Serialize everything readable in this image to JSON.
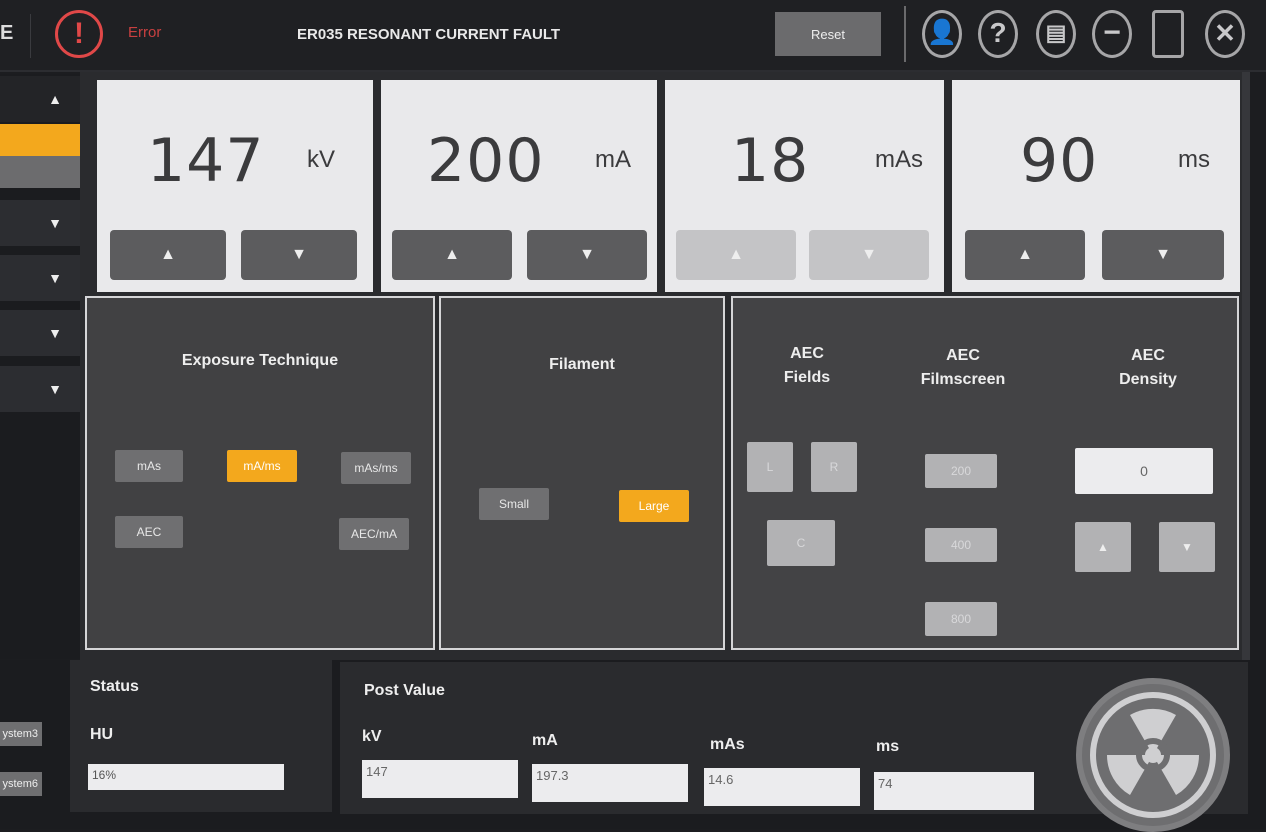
{
  "header": {
    "logo": "E",
    "error_icon": "!",
    "error_label": "Error",
    "message": "ER035 RESONANT CURRENT FAULT",
    "reset_label": "Reset",
    "icons": [
      "user-icon",
      "help-icon",
      "notes-icon",
      "minimize-icon",
      "window-icon",
      "close-icon"
    ],
    "icon_glyphs": [
      "👤",
      "?",
      "▤",
      "−",
      "",
      "✕"
    ]
  },
  "sidebar": {
    "up_arrow": "▲",
    "down_arrow": "▼",
    "system_buttons": [
      "ystem3",
      "ystem6"
    ]
  },
  "values": [
    {
      "value": "147",
      "unit": "kV",
      "up": "▲",
      "down": "▼",
      "enabled": true
    },
    {
      "value": "200",
      "unit": "mA",
      "up": "▲",
      "down": "▼",
      "enabled": true
    },
    {
      "value": "18",
      "unit": "mAs",
      "up": "▲",
      "down": "▼",
      "enabled": false
    },
    {
      "value": "90",
      "unit": "ms",
      "up": "▲",
      "down": "▼",
      "enabled": true
    }
  ],
  "exposure": {
    "title": "Exposure Technique",
    "options": [
      "mAs",
      "mA/ms",
      "mAs/ms",
      "AEC",
      "AEC/mA"
    ],
    "selected": "mA/ms"
  },
  "filament": {
    "title": "Filament",
    "options": [
      "Small",
      "Large"
    ],
    "selected": "Large"
  },
  "aec": {
    "fields_title": "AEC\nFields",
    "filmscreen_title": "AEC\nFilmscreen",
    "density_title": "AEC\nDensity",
    "fields": [
      "L",
      "R",
      "C"
    ],
    "filmscreen": [
      "200",
      "400",
      "800"
    ],
    "density": "0",
    "up": "▲",
    "down": "▼"
  },
  "status": {
    "title": "Status",
    "hu_label": "HU",
    "hu_value": "16%"
  },
  "post": {
    "title": "Post Value",
    "labels": [
      "kV",
      "mA",
      "mAs",
      "ms"
    ],
    "values": [
      "147",
      "197.3",
      "14.6",
      "74"
    ]
  },
  "colors": {
    "accent": "#f3a81d",
    "error": "#e04848"
  }
}
